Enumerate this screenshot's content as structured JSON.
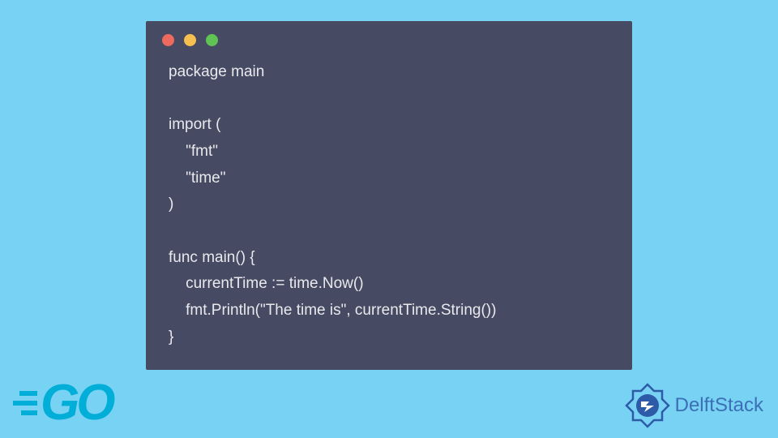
{
  "code": {
    "lines": [
      "package main",
      "",
      "import (",
      "    \"fmt\"",
      "    \"time\"",
      ")",
      "",
      "func main() {",
      "    currentTime := time.Now()",
      "    fmt.Println(\"The time is\", currentTime.String())",
      "}"
    ]
  },
  "branding": {
    "go_label": "GO",
    "delftstack_label": "DelftStack"
  },
  "colors": {
    "background": "#78d2f4",
    "window": "#474a63",
    "code_text": "#e8e9ed",
    "go_brand": "#00aed8",
    "delft_brand": "#3b6fb6"
  }
}
